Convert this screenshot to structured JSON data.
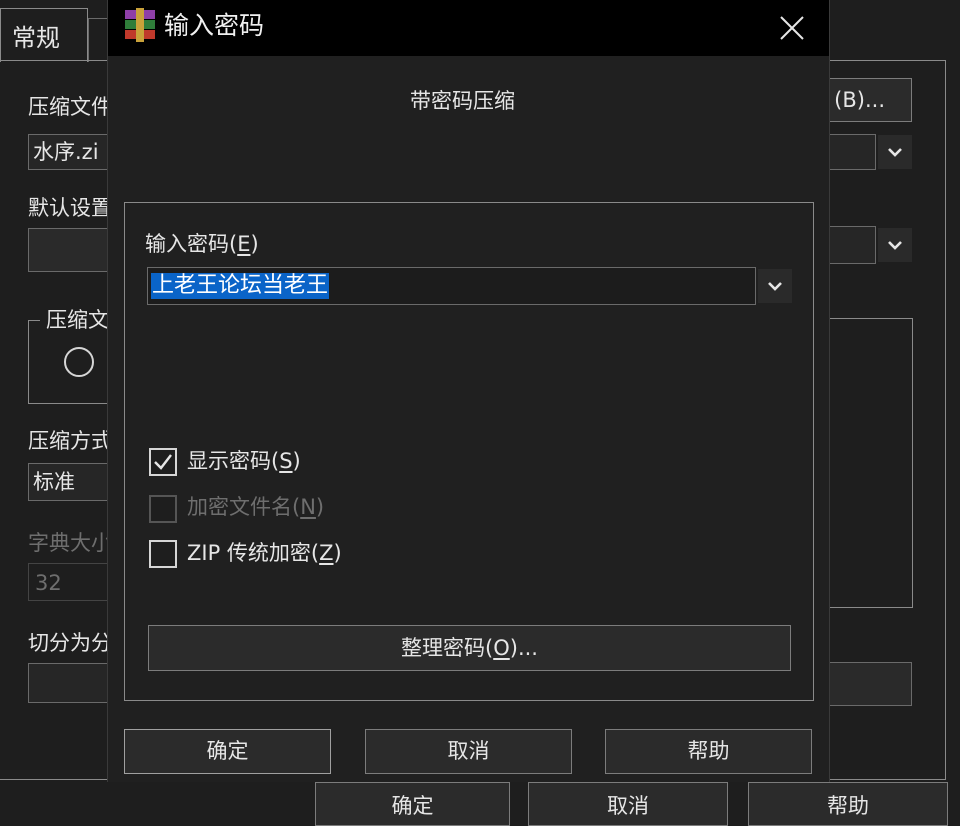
{
  "background": {
    "tab_label": "常规",
    "archive_name_label": "压缩文件",
    "archive_name_value": "水序.zi",
    "browse_button": "(B)...",
    "default_settings_label": "默认设置",
    "archive_format_group": "压缩文",
    "compression_method_label": "压缩方式",
    "compression_method_value": "标准",
    "dictionary_size_label": "字典大小",
    "dictionary_size_value": "32",
    "split_label": "切分为分",
    "ok_button_partial": "确定",
    "cancel_button_partial": "取消",
    "help_button_partial": "帮助"
  },
  "dialog": {
    "title": "输入密码",
    "subtitle": "带密码压缩",
    "password_label": "输入密码",
    "password_label_key": "E",
    "password_value": "上老王论坛当老王",
    "show_password": {
      "label": "显示密码",
      "key": "S",
      "checked": true,
      "enabled": true
    },
    "encrypt_filenames": {
      "label": "加密文件名",
      "key": "N",
      "checked": false,
      "enabled": false
    },
    "zip_legacy": {
      "label": "ZIP 传统加密",
      "key": "Z",
      "checked": false,
      "enabled": true
    },
    "organize_button": {
      "label": "整理密码",
      "key": "O",
      "suffix": "..."
    },
    "ok_button": "确定",
    "cancel_button": "取消",
    "help_button": "帮助"
  },
  "colors": {
    "background": "#1e1e1e",
    "titlebar": "#000000",
    "selection": "#0a64c8",
    "text": "#e6e6e6",
    "disabled_text": "#6e6e6e"
  },
  "icons": [
    "winrar-icon",
    "close-icon",
    "chevron-down-icon",
    "check-icon"
  ]
}
